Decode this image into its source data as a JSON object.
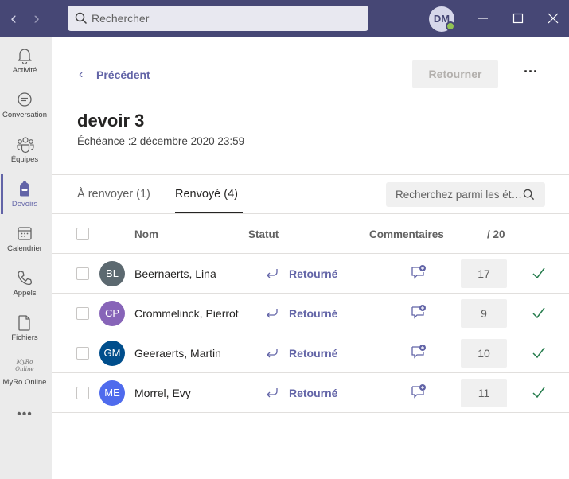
{
  "titlebar": {
    "search_placeholder": "Rechercher",
    "user_initials": "DM"
  },
  "rail": {
    "items": [
      {
        "label": "Activité",
        "icon": "bell-icon"
      },
      {
        "label": "Conversation",
        "icon": "chat-icon"
      },
      {
        "label": "Équipes",
        "icon": "teams-icon"
      },
      {
        "label": "Devoirs",
        "icon": "assignments-icon"
      },
      {
        "label": "Calendrier",
        "icon": "calendar-icon"
      },
      {
        "label": "Appels",
        "icon": "phone-icon"
      },
      {
        "label": "Fichiers",
        "icon": "file-icon"
      },
      {
        "label": "MyRo Online",
        "icon": "myro-logo"
      }
    ],
    "myro_logo_text": "MyRo Online",
    "active_index": 3
  },
  "header": {
    "back_label": "Précédent",
    "return_button": "Retourner"
  },
  "assignment": {
    "title": "devoir 3",
    "due": "Échéance :2 décembre 2020 23:59"
  },
  "tabs": [
    {
      "label": "À renvoyer (1)",
      "active": false
    },
    {
      "label": "Renvoyé (4)",
      "active": true
    }
  ],
  "student_search_placeholder": "Recherchez parmi les ét…",
  "table": {
    "columns": {
      "name": "Nom",
      "status": "Statut",
      "comments": "Commentaires",
      "score": "/ 20"
    },
    "rows": [
      {
        "initials": "BL",
        "avatar_color": "#5c6970",
        "name": "Beernaerts, Lina",
        "status": "Retourné",
        "grade": "17"
      },
      {
        "initials": "CP",
        "avatar_color": "#8764b8",
        "name": "Crommelinck, Pierrot",
        "status": "Retourné",
        "grade": "9"
      },
      {
        "initials": "GM",
        "avatar_color": "#004e8c",
        "name": "Geeraerts, Martin",
        "status": "Retourné",
        "grade": "10"
      },
      {
        "initials": "ME",
        "avatar_color": "#4f6bed",
        "name": "Morrel, Evy",
        "status": "Retourné",
        "grade": "11"
      }
    ]
  },
  "colors": {
    "brand": "#6264a7",
    "titlebar": "#464775",
    "success": "#237b4b"
  }
}
